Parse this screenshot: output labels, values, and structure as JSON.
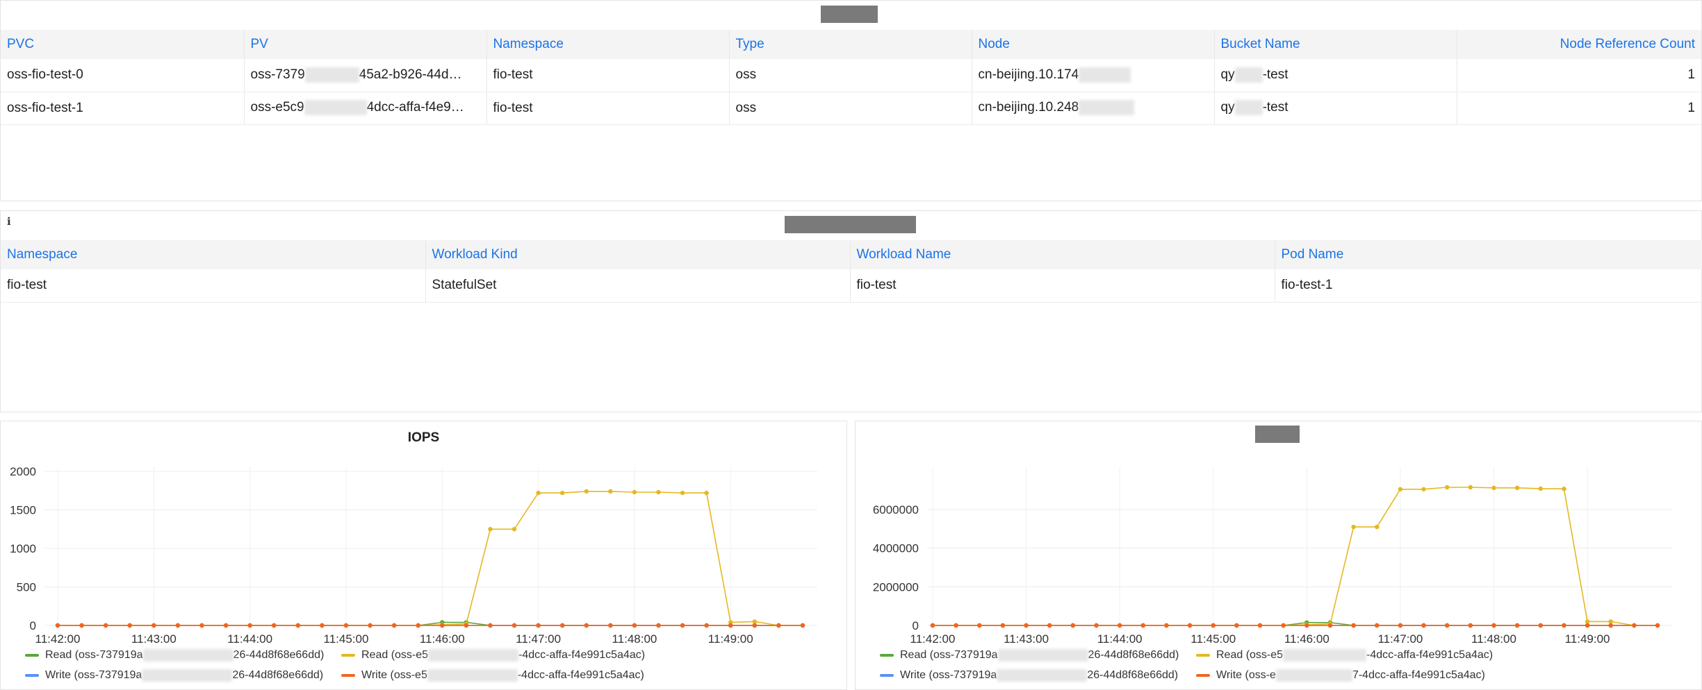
{
  "colors": {
    "accent": "#1a73e8",
    "read_green": "#5aa83c",
    "read_yellow": "#e4b820",
    "write_blue": "#5b8ff9",
    "write_orange": "#f26522"
  },
  "pv_table": {
    "headers": [
      "PVC",
      "PV",
      "Namespace",
      "Type",
      "Node",
      "Bucket Name",
      "Node Reference Count"
    ],
    "rows": [
      {
        "pvc": "oss-fio-test-0",
        "pv_start": "oss-7379",
        "pv_end": "45a2-b926-44d…",
        "namespace": "fio-test",
        "type": "oss",
        "node_start": "cn-beijing.10.174",
        "bucket_start": "qy",
        "bucket_end": "-test",
        "count": "1"
      },
      {
        "pvc": "oss-fio-test-1",
        "pv_start": "oss-e5c9",
        "pv_end": "4dcc-affa-f4e9…",
        "namespace": "fio-test",
        "type": "oss",
        "node_start": "cn-beijing.10.248",
        "bucket_start": "qy",
        "bucket_end": "-test",
        "count": "1"
      }
    ]
  },
  "workload_table": {
    "info_icon": "info-icon",
    "headers": [
      "Namespace",
      "Workload Kind",
      "Workload Name",
      "Pod Name"
    ],
    "rows": [
      {
        "namespace": "fio-test",
        "kind": "StatefulSet",
        "name": "fio-test",
        "pod": "fio-test-1"
      }
    ]
  },
  "chart_data": [
    {
      "type": "line",
      "title": "IOPS",
      "x": [
        "11:42:00",
        "11:42:15",
        "11:42:30",
        "11:42:45",
        "11:43:00",
        "11:43:15",
        "11:43:30",
        "11:43:45",
        "11:44:00",
        "11:44:15",
        "11:44:30",
        "11:44:45",
        "11:45:00",
        "11:45:15",
        "11:45:30",
        "11:45:45",
        "11:46:00",
        "11:46:15",
        "11:46:30",
        "11:46:45",
        "11:47:00",
        "11:47:15",
        "11:47:30",
        "11:47:45",
        "11:48:00",
        "11:48:15",
        "11:48:30",
        "11:48:45",
        "11:49:00",
        "11:49:15",
        "11:49:30",
        "11:49:45"
      ],
      "x_ticks": [
        "11:42:00",
        "11:43:00",
        "11:44:00",
        "11:45:00",
        "11:46:00",
        "11:47:00",
        "11:48:00",
        "11:49:00"
      ],
      "ylim": [
        0,
        2000
      ],
      "y_ticks": [
        "0",
        "500",
        "1000",
        "1500",
        "2000"
      ],
      "y_tick_values": [
        0,
        500,
        1000,
        1500,
        2000
      ],
      "grid": true,
      "legend_position": "bottom",
      "series": [
        {
          "name": "Read (oss-737919a",
          "name_end": "26-44d8f68e66dd)",
          "color": "#5aa83c",
          "values": [
            0,
            0,
            0,
            0,
            0,
            0,
            0,
            0,
            0,
            0,
            0,
            0,
            0,
            0,
            0,
            0,
            40,
            40,
            0,
            0,
            0,
            0,
            0,
            0,
            0,
            0,
            0,
            0,
            0,
            0,
            0,
            0
          ]
        },
        {
          "name": "Read (oss-e5",
          "name_end": "-4dcc-affa-f4e991c5a4ac)",
          "color": "#e4b820",
          "values": [
            0,
            0,
            0,
            0,
            0,
            0,
            0,
            0,
            0,
            0,
            0,
            0,
            0,
            0,
            0,
            0,
            10,
            20,
            1250,
            1250,
            1720,
            1720,
            1740,
            1740,
            1730,
            1730,
            1720,
            1720,
            40,
            50,
            0,
            0
          ]
        },
        {
          "name": "Write (oss-737919a",
          "name_end": "26-44d8f68e66dd)",
          "color": "#5b8ff9",
          "values": [
            0,
            0,
            0,
            0,
            0,
            0,
            0,
            0,
            0,
            0,
            0,
            0,
            0,
            0,
            0,
            0,
            0,
            0,
            0,
            0,
            0,
            0,
            0,
            0,
            0,
            0,
            0,
            0,
            0,
            0,
            0,
            0
          ]
        },
        {
          "name": "Write (oss-e5",
          "name_end": "-4dcc-affa-f4e991c5a4ac)",
          "color": "#f26522",
          "values": [
            0,
            0,
            0,
            0,
            0,
            0,
            0,
            0,
            0,
            0,
            0,
            0,
            0,
            0,
            0,
            0,
            0,
            0,
            0,
            0,
            0,
            0,
            0,
            0,
            0,
            0,
            0,
            0,
            0,
            0,
            0,
            0
          ]
        }
      ]
    },
    {
      "type": "line",
      "title": "",
      "x": [
        "11:42:00",
        "11:42:15",
        "11:42:30",
        "11:42:45",
        "11:43:00",
        "11:43:15",
        "11:43:30",
        "11:43:45",
        "11:44:00",
        "11:44:15",
        "11:44:30",
        "11:44:45",
        "11:45:00",
        "11:45:15",
        "11:45:30",
        "11:45:45",
        "11:46:00",
        "11:46:15",
        "11:46:30",
        "11:46:45",
        "11:47:00",
        "11:47:15",
        "11:47:30",
        "11:47:45",
        "11:48:00",
        "11:48:15",
        "11:48:30",
        "11:48:45",
        "11:49:00",
        "11:49:15",
        "11:49:30",
        "11:49:45"
      ],
      "x_ticks": [
        "11:42:00",
        "11:43:00",
        "11:44:00",
        "11:45:00",
        "11:46:00",
        "11:47:00",
        "11:48:00",
        "11:49:00"
      ],
      "ylim": [
        0,
        8000000
      ],
      "y_ticks": [
        "0",
        "2000000",
        "4000000",
        "6000000"
      ],
      "y_tick_values": [
        0,
        2000000,
        4000000,
        6000000
      ],
      "grid": true,
      "legend_position": "bottom",
      "series": [
        {
          "name": "Read (oss-737919a",
          "name_end": "26-44d8f68e66dd)",
          "color": "#5aa83c",
          "values": [
            0,
            0,
            0,
            0,
            0,
            0,
            0,
            0,
            0,
            0,
            0,
            0,
            0,
            0,
            0,
            0,
            150000,
            150000,
            0,
            0,
            0,
            0,
            0,
            0,
            0,
            0,
            0,
            0,
            0,
            0,
            0,
            0
          ]
        },
        {
          "name": "Read (oss-e5",
          "name_end": "-4dcc-affa-f4e991c5a4ac)",
          "color": "#e4b820",
          "values": [
            0,
            0,
            0,
            0,
            0,
            0,
            0,
            0,
            0,
            0,
            0,
            0,
            0,
            0,
            0,
            0,
            40000,
            80000,
            5100000,
            5100000,
            7050000,
            7050000,
            7150000,
            7150000,
            7120000,
            7120000,
            7080000,
            7070000,
            200000,
            200000,
            0,
            0
          ]
        },
        {
          "name": "Write (oss-737919a",
          "name_end": "26-44d8f68e66dd)",
          "color": "#5b8ff9",
          "values": [
            0,
            0,
            0,
            0,
            0,
            0,
            0,
            0,
            0,
            0,
            0,
            0,
            0,
            0,
            0,
            0,
            0,
            0,
            0,
            0,
            0,
            0,
            0,
            0,
            0,
            0,
            0,
            0,
            0,
            0,
            0,
            0
          ]
        },
        {
          "name": "Write (oss-e",
          "name_end": "7-4dcc-affa-f4e991c5a4ac)",
          "color": "#f26522",
          "values": [
            0,
            0,
            0,
            0,
            0,
            0,
            0,
            0,
            0,
            0,
            0,
            0,
            0,
            0,
            0,
            0,
            0,
            0,
            0,
            0,
            0,
            0,
            0,
            0,
            0,
            0,
            0,
            0,
            0,
            0,
            0,
            0
          ]
        }
      ]
    }
  ]
}
